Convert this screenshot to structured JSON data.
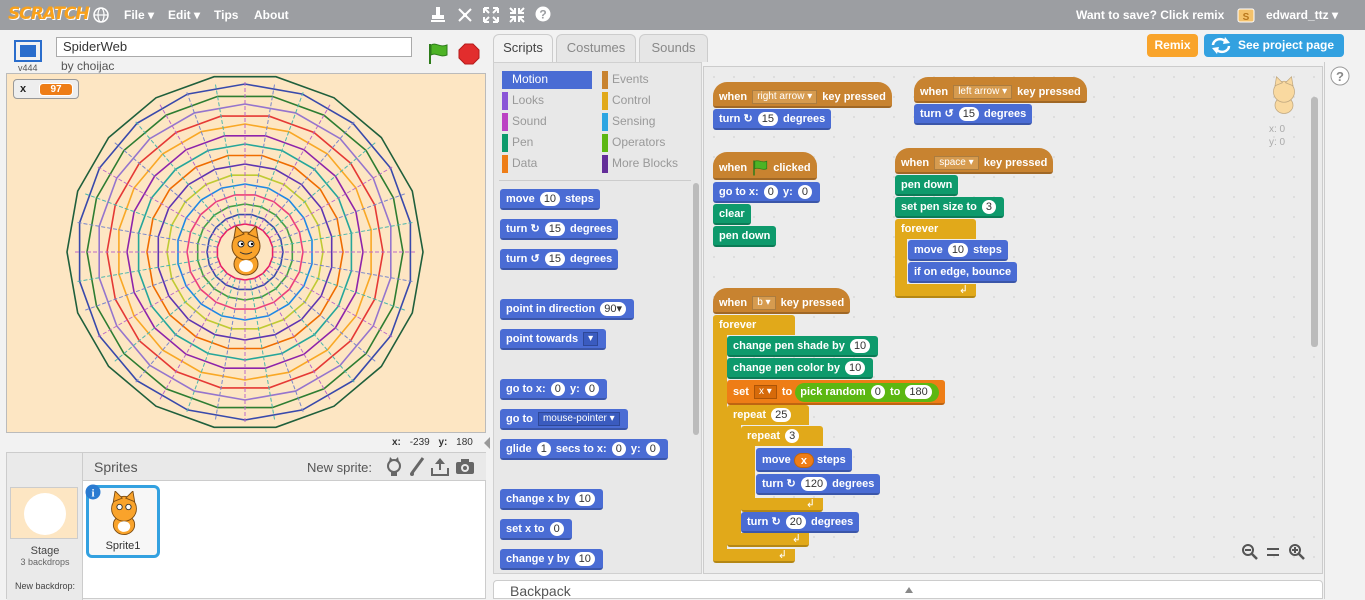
{
  "menubar": {
    "logo": "SCRATCH",
    "file": "File ▾",
    "edit": "Edit ▾",
    "tips": "Tips",
    "about": "About",
    "save_prompt": "Want to save? Click remix",
    "username": "edward_ttz ▾"
  },
  "stage_header": {
    "version": "v444",
    "project_title": "SpiderWeb",
    "author": "by choijac"
  },
  "variable_monitor": {
    "name": "x",
    "value": "97"
  },
  "stage_coords": {
    "x_label": "x:",
    "x_value": "-239",
    "y_label": "y:",
    "y_value": "180"
  },
  "sprites_pane": {
    "heading": "Sprites",
    "new_sprite_label": "New sprite:",
    "stage_label": "Stage",
    "backdrop_count": "3 backdrops",
    "new_backdrop_label": "New backdrop:",
    "sprite_name": "Sprite1"
  },
  "tabs": [
    "Scripts",
    "Costumes",
    "Sounds"
  ],
  "buttons": {
    "remix": "Remix",
    "see_project": "See project page"
  },
  "categories": [
    {
      "label": "Motion",
      "color": "#4a6cd4"
    },
    {
      "label": "Looks",
      "color": "#8a55d7"
    },
    {
      "label": "Sound",
      "color": "#bb42c3"
    },
    {
      "label": "Pen",
      "color": "#0e9a6c"
    },
    {
      "label": "Data",
      "color": "#ee7d16"
    },
    {
      "label": "Events",
      "color": "#c88330"
    },
    {
      "label": "Control",
      "color": "#e1a91a"
    },
    {
      "label": "Sensing",
      "color": "#2ca5e2"
    },
    {
      "label": "Operators",
      "color": "#5cb712"
    },
    {
      "label": "More Blocks",
      "color": "#632d99"
    }
  ],
  "palette_blocks": {
    "move": "move",
    "move_n": "10",
    "steps": "steps",
    "turn": "turn",
    "turn_n": "15",
    "degrees": "degrees",
    "point_dir": "point in direction",
    "point_dir_n": "90▾",
    "point_towards": "point towards",
    "goto_xy": "go to x:",
    "goto_x": "0",
    "goto_y_label": "y:",
    "goto_y": "0",
    "goto": "go to",
    "goto_target": "mouse-pointer ▾",
    "glide": "glide",
    "glide_n": "1",
    "glide_secs": "secs to x:",
    "glide_x": "0",
    "glide_y_label": "y:",
    "glide_y": "0",
    "change_x": "change x by",
    "change_x_n": "10",
    "set_x": "set x to",
    "set_x_n": "0",
    "change_y": "change y by",
    "change_y_n": "10"
  },
  "scripts": {
    "when": "when",
    "key_pressed": "key pressed",
    "clicked": "clicked",
    "right_arrow": "right arrow ▾",
    "left_arrow": "left arrow ▾",
    "space": "space ▾",
    "b": "b ▾",
    "turn": "turn",
    "degrees": "degrees",
    "n15": "15",
    "goto": "go to x:",
    "y": "y:",
    "zero": "0",
    "clear": "clear",
    "pen_down": "pen down",
    "set_pen_size": "set pen size to",
    "pen_size": "3",
    "forever": "forever",
    "move": "move",
    "steps": "steps",
    "n10": "10",
    "bounce": "if on edge, bounce",
    "change_shade": "change pen shade by",
    "change_color": "change pen color by",
    "set": "set",
    "x_var": "x ▾",
    "to": "to",
    "pick_random": "pick random",
    "rand_min": "0",
    "rand_to": "to",
    "rand_max": "180",
    "repeat": "repeat",
    "n25": "25",
    "n3": "3",
    "x": "x",
    "n120": "120",
    "n20": "20"
  },
  "sprite_info": {
    "x": "x: 0",
    "y": "y: 0"
  },
  "backpack": "Backpack"
}
